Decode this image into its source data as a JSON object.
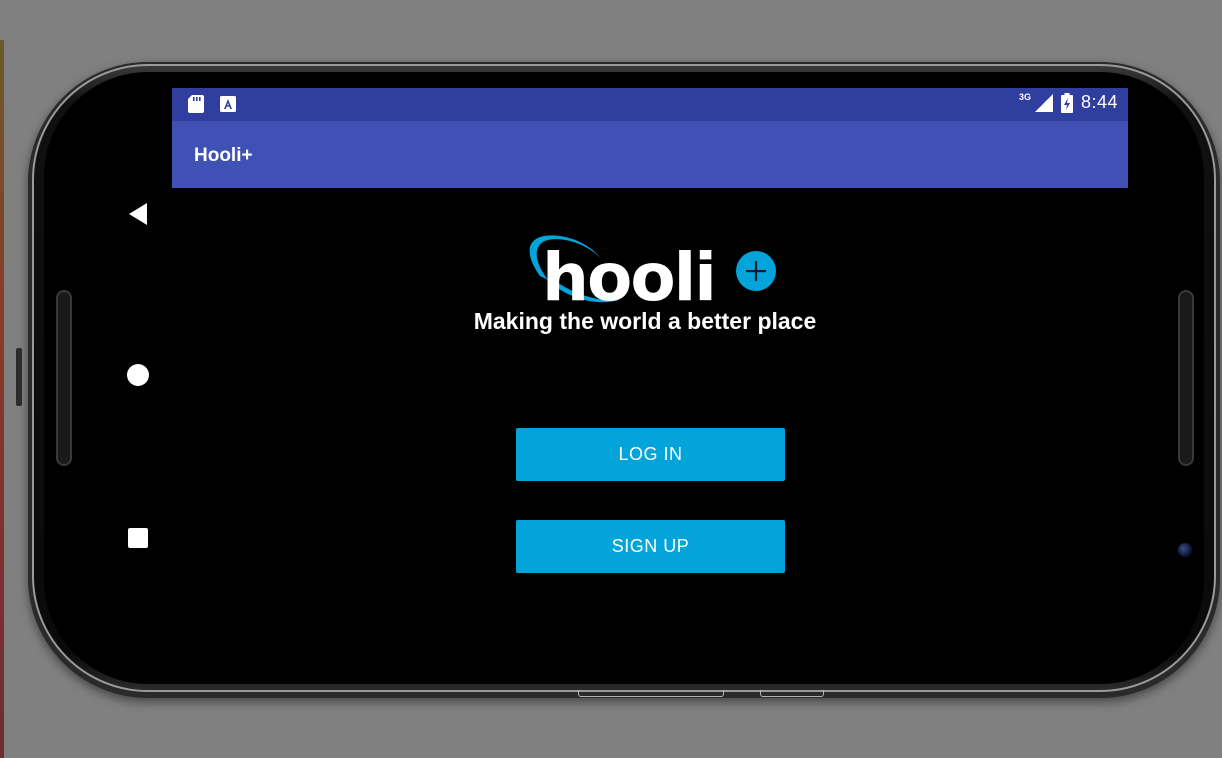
{
  "status_bar": {
    "time": "8:44",
    "network": "3G",
    "icons": [
      "sd-card-icon",
      "accessibility-app-icon",
      "signal-icon",
      "battery-charging-icon"
    ],
    "color": "#303f9f"
  },
  "app_bar": {
    "title": "Hooli+",
    "color": "#3f51b5"
  },
  "navigation": {
    "buttons": [
      "back-icon",
      "home-icon",
      "recents-icon"
    ]
  },
  "main": {
    "logo_text": "hooli",
    "tagline": "Making the world a better place",
    "login_label": "LOG IN",
    "signup_label": "SIGN UP",
    "button_color": "#02a4d9"
  }
}
